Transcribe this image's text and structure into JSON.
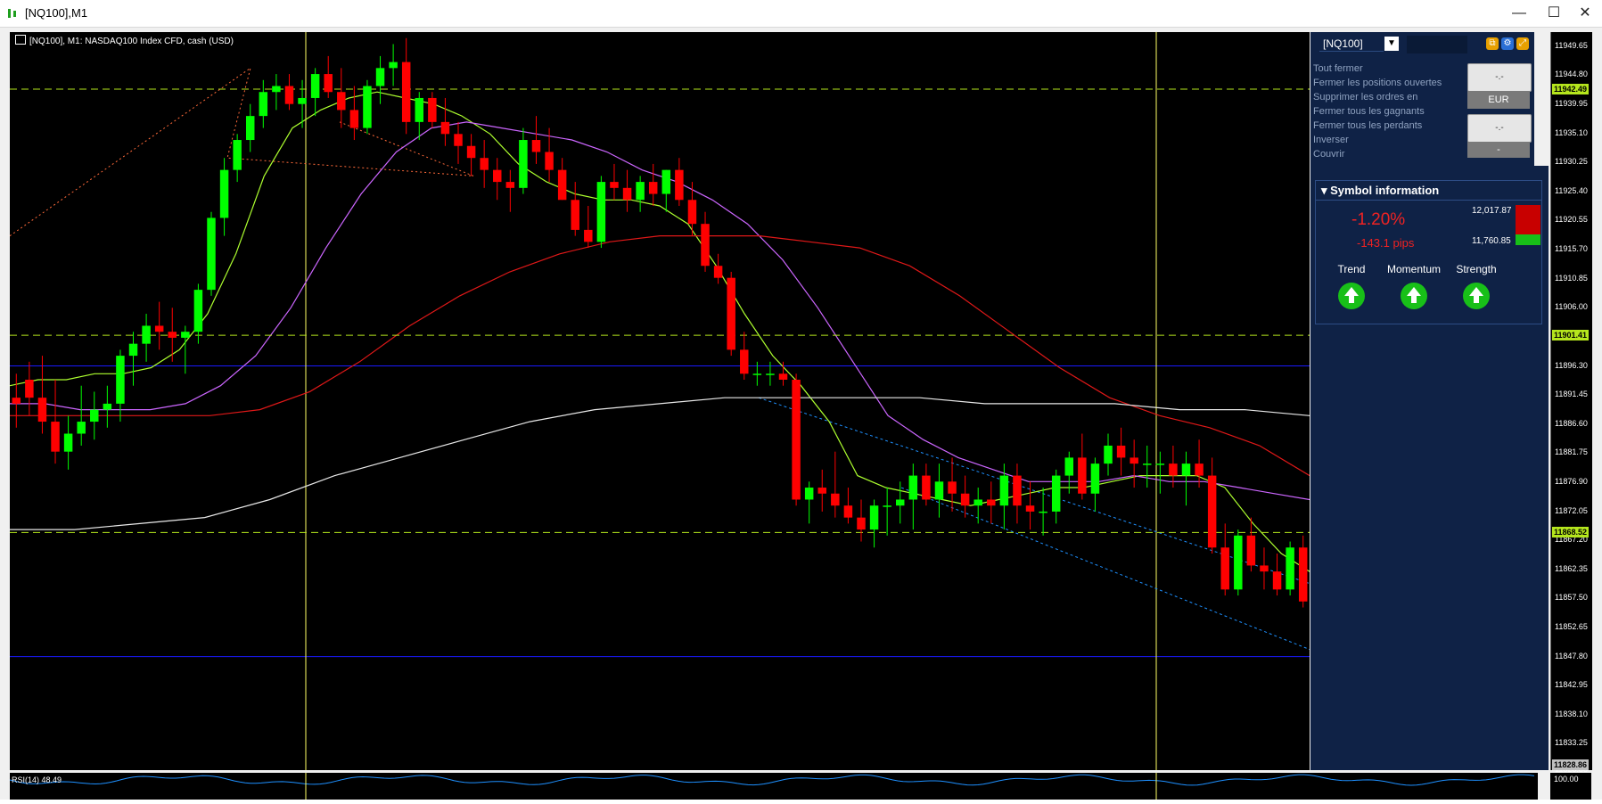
{
  "window": {
    "title": "[NQ100],M1",
    "min_label": "—",
    "max_label": "☐",
    "close_label": "✕"
  },
  "chart": {
    "header": "[NQ100], M1:  NASDAQ100 Index CFD, cash (USD)",
    "price_ticks": [
      "11949.65",
      "11944.80",
      "11939.95",
      "11935.10",
      "11930.25",
      "11925.40",
      "11920.55",
      "11915.70",
      "11910.85",
      "11906.00",
      "11901.15",
      "11896.30",
      "11891.45",
      "11886.60",
      "11881.75",
      "11876.90",
      "11872.05",
      "11867.20",
      "11862.35",
      "11857.50",
      "11852.65",
      "11847.80",
      "11842.95",
      "11838.10",
      "11833.25",
      "11828.86"
    ],
    "price_tags": [
      {
        "label": "11942.49",
        "color": "#b5e61d"
      },
      {
        "label": "11901.41",
        "color": "#b5e61d"
      },
      {
        "label": "11868.52",
        "color": "#b5e61d"
      },
      {
        "label": "11828.86",
        "color": "#bfbfbf"
      }
    ],
    "colors": {
      "bull": "#00ff00",
      "bear": "#ff0000",
      "ma_fast": "#adff2f",
      "ma_mid": "#cc66ff",
      "ma_slow": "#e01818",
      "ma_long": "#e8e8e8",
      "hline": "#b5e61d",
      "vline": "#ffff66",
      "channel": "#1e90ff"
    }
  },
  "chart_data": {
    "type": "candlestick",
    "symbol": "[NQ100]",
    "timeframe": "M1",
    "ylim": [
      11828.86,
      11952.0
    ],
    "candles": [
      [
        11891,
        11895,
        11886,
        11890
      ],
      [
        11894,
        11897,
        11888,
        11891
      ],
      [
        11891,
        11898,
        11885,
        11887
      ],
      [
        11887,
        11894,
        11880,
        11882
      ],
      [
        11882,
        11888,
        11879,
        11885
      ],
      [
        11885,
        11893,
        11883,
        11887
      ],
      [
        11887,
        11892,
        11884,
        11889
      ],
      [
        11889,
        11893,
        11886,
        11890
      ],
      [
        11890,
        11899,
        11887,
        11898
      ],
      [
        11898,
        11902,
        11893,
        11900
      ],
      [
        11900,
        11905,
        11897,
        11903
      ],
      [
        11903,
        11907,
        11899,
        11902
      ],
      [
        11902,
        11906,
        11897,
        11901
      ],
      [
        11901,
        11903,
        11895,
        11902
      ],
      [
        11902,
        11910,
        11900,
        11909
      ],
      [
        11909,
        11922,
        11908,
        11921
      ],
      [
        11921,
        11931,
        11918,
        11929
      ],
      [
        11929,
        11935,
        11927,
        11934
      ],
      [
        11934,
        11940,
        11932,
        11938
      ],
      [
        11938,
        11944,
        11936,
        11942
      ],
      [
        11942,
        11945,
        11939,
        11943
      ],
      [
        11943,
        11945,
        11939,
        11940
      ],
      [
        11940,
        11944,
        11936,
        11941
      ],
      [
        11941,
        11946,
        11938,
        11945
      ],
      [
        11945,
        11948,
        11941,
        11942
      ],
      [
        11942,
        11946,
        11936,
        11939
      ],
      [
        11939,
        11943,
        11934,
        11936
      ],
      [
        11936,
        11944,
        11935,
        11943
      ],
      [
        11943,
        11948,
        11940,
        11946
      ],
      [
        11946,
        11950,
        11943,
        11947
      ],
      [
        11947,
        11951,
        11935,
        11937
      ],
      [
        11937,
        11942,
        11934,
        11941
      ],
      [
        11941,
        11942,
        11936,
        11937
      ],
      [
        11937,
        11941,
        11933,
        11935
      ],
      [
        11935,
        11937,
        11930,
        11933
      ],
      [
        11933,
        11935,
        11928,
        11931
      ],
      [
        11931,
        11934,
        11926,
        11929
      ],
      [
        11929,
        11931,
        11924,
        11927
      ],
      [
        11927,
        11929,
        11922,
        11926
      ],
      [
        11926,
        11936,
        11925,
        11934
      ],
      [
        11934,
        11938,
        11930,
        11932
      ],
      [
        11932,
        11936,
        11927,
        11929
      ],
      [
        11929,
        11931,
        11924,
        11924
      ],
      [
        11924,
        11927,
        11918,
        11919
      ],
      [
        11919,
        11923,
        11916,
        11917
      ],
      [
        11917,
        11928,
        11916,
        11927
      ],
      [
        11927,
        11930,
        11924,
        11926
      ],
      [
        11926,
        11929,
        11922,
        11924
      ],
      [
        11924,
        11928,
        11922,
        11927
      ],
      [
        11927,
        11930,
        11923,
        11925
      ],
      [
        11925,
        11929,
        11922,
        11929
      ],
      [
        11929,
        11931,
        11923,
        11924
      ],
      [
        11924,
        11927,
        11918,
        11920
      ],
      [
        11920,
        11922,
        11912,
        11913
      ],
      [
        11913,
        11915,
        11910,
        11911
      ],
      [
        11911,
        11912,
        11898,
        11899
      ],
      [
        11899,
        11902,
        11894,
        11895
      ],
      [
        11895,
        11897,
        11893,
        11895
      ],
      [
        11895,
        11897,
        11893,
        11895
      ],
      [
        11895,
        11897,
        11893,
        11894
      ],
      [
        11894,
        11895,
        11873,
        11874
      ],
      [
        11874,
        11877,
        11870,
        11876
      ],
      [
        11876,
        11879,
        11872,
        11875
      ],
      [
        11875,
        11882,
        11871,
        11873
      ],
      [
        11873,
        11876,
        11870,
        11871
      ],
      [
        11871,
        11874,
        11867,
        11869
      ],
      [
        11869,
        11874,
        11866,
        11873
      ],
      [
        11873,
        11876,
        11868,
        11873
      ],
      [
        11873,
        11877,
        11870,
        11874
      ],
      [
        11874,
        11880,
        11869,
        11878
      ],
      [
        11878,
        11880,
        11873,
        11874
      ],
      [
        11874,
        11880,
        11871,
        11877
      ],
      [
        11877,
        11881,
        11872,
        11875
      ],
      [
        11875,
        11878,
        11871,
        11873
      ],
      [
        11873,
        11876,
        11870,
        11874
      ],
      [
        11874,
        11877,
        11870,
        11873
      ],
      [
        11873,
        11880,
        11869,
        11878
      ],
      [
        11878,
        11880,
        11870,
        11873
      ],
      [
        11873,
        11877,
        11869,
        11872
      ],
      [
        11872,
        11876,
        11868,
        11872
      ],
      [
        11872,
        11879,
        11870,
        11878
      ],
      [
        11878,
        11882,
        11875,
        11881
      ],
      [
        11881,
        11885,
        11874,
        11875
      ],
      [
        11875,
        11881,
        11872,
        11880
      ],
      [
        11880,
        11885,
        11878,
        11883
      ],
      [
        11883,
        11886,
        11878,
        11881
      ],
      [
        11881,
        11884,
        11876,
        11880
      ],
      [
        11880,
        11883,
        11876,
        11880
      ],
      [
        11880,
        11882,
        11875,
        11880
      ],
      [
        11880,
        11883,
        11876,
        11878
      ],
      [
        11878,
        11882,
        11873,
        11880
      ],
      [
        11880,
        11884,
        11876,
        11878
      ],
      [
        11878,
        11881,
        11865,
        11866
      ],
      [
        11866,
        11870,
        11858,
        11859
      ],
      [
        11859,
        11869,
        11858,
        11868
      ],
      [
        11868,
        11871,
        11862,
        11863
      ],
      [
        11863,
        11866,
        11859,
        11862
      ],
      [
        11862,
        11865,
        11858,
        11859
      ],
      [
        11859,
        11867,
        11858,
        11866
      ],
      [
        11866,
        11868,
        11856,
        11857
      ]
    ],
    "moving_averages": [
      {
        "color": "#adff2f",
        "values": [
          11893,
          11894,
          11894,
          11895,
          11895,
          11896,
          11899,
          11905,
          11915,
          11928,
          11936,
          11939,
          11941,
          11942,
          11941,
          11940,
          11938,
          11935,
          11930,
          11927,
          11925,
          11924,
          11924,
          11923,
          11920,
          11913,
          11905,
          11898,
          11893,
          11887,
          11878,
          11876,
          11875,
          11874,
          11873,
          11874,
          11875,
          11876,
          11876,
          11877,
          11878,
          11878,
          11878,
          11876,
          11870,
          11865,
          11862
        ]
      },
      {
        "color": "#cc66ff",
        "values": [
          11890,
          11890,
          11889,
          11889,
          11889,
          11890,
          11893,
          11898,
          11906,
          11916,
          11925,
          11932,
          11936,
          11937,
          11936,
          11935,
          11934,
          11932,
          11929,
          11927,
          11924,
          11920,
          11914,
          11906,
          11897,
          11888,
          11884,
          11881,
          11879,
          11877,
          11877,
          11877,
          11878,
          11877,
          11877,
          11876,
          11875,
          11874
        ]
      },
      {
        "color": "#e01818",
        "values": [
          11888,
          11888,
          11888,
          11888,
          11888,
          11889,
          11892,
          11897,
          11903,
          11908,
          11912,
          11915,
          11917,
          11918,
          11918,
          11918,
          11917,
          11916,
          11913,
          11908,
          11902,
          11896,
          11891,
          11888,
          11886,
          11883,
          11878
        ]
      },
      {
        "color": "#e8e8e8",
        "values": [
          11869,
          11869,
          11870,
          11871,
          11874,
          11878,
          11881,
          11884,
          11887,
          11889,
          11890,
          11891,
          11891,
          11891,
          11891,
          11890,
          11890,
          11890,
          11889,
          11889,
          11888
        ]
      }
    ],
    "horizontal_levels": [
      11942.49,
      11901.41,
      11868.52
    ],
    "blue_levels": [
      11896.3,
      11847.8
    ]
  },
  "panel": {
    "symbol": "[NQ100]",
    "dropdown_icon": "chevron-down-icon",
    "menu": [
      "Tout fermer",
      "Fermer les positions ouvertes",
      "Supprimer les ordres en",
      "Fermer tous les gagnants",
      "Fermer tous les perdants",
      "Inverser",
      "Couvrir"
    ],
    "btn1": "-.-",
    "currency": "EUR",
    "btn2": "-.-",
    "btn3": "-"
  },
  "symbol_info": {
    "title": "Symbol information",
    "change_pct": "-1.20%",
    "change_pips": "-143.1 pips",
    "high": "12,017.87",
    "low": "11,760.85",
    "trend_label": "Trend",
    "momentum_label": "Momentum",
    "strength_label": "Strength",
    "trend": "up",
    "momentum": "up",
    "strength": "up"
  },
  "rsi": {
    "label": "RSI(14) 48.49",
    "scale_top": "100.00"
  }
}
